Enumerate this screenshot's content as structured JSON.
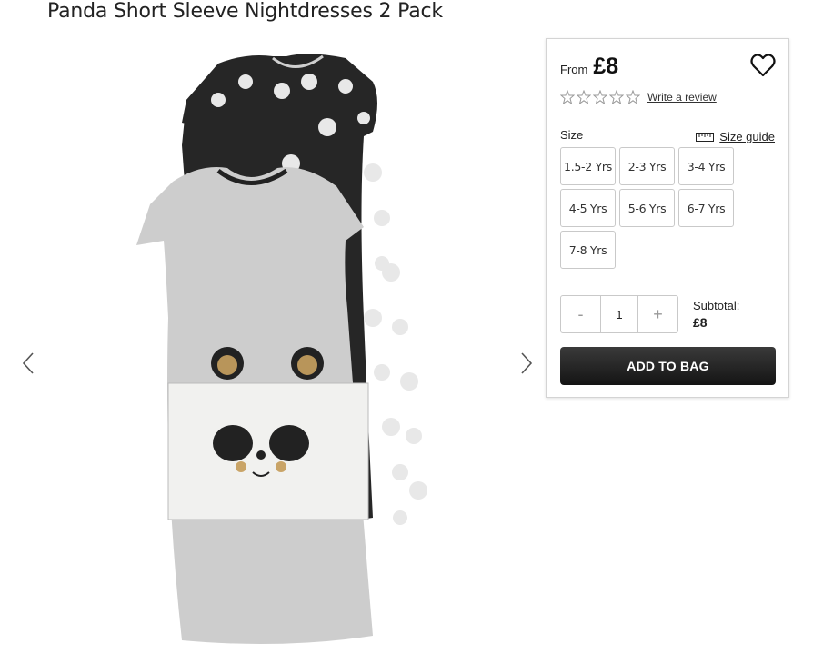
{
  "product": {
    "title": "Panda Short Sleeve Nightdresses 2 Pack"
  },
  "gallery": {
    "prev_icon": "chevron-left-icon",
    "next_icon": "chevron-right-icon"
  },
  "purchase": {
    "from_label": "From",
    "price": "£8",
    "rating": {
      "stars": 0,
      "max": 5
    },
    "review_link": "Write a review",
    "size_label": "Size",
    "size_guide_label": "Size guide",
    "sizes": [
      "1.5-2 Yrs",
      "2-3 Yrs",
      "3-4 Yrs",
      "4-5 Yrs",
      "5-6 Yrs",
      "6-7 Yrs",
      "7-8 Yrs"
    ],
    "quantity": {
      "decrement": "-",
      "value": "1",
      "increment": "+"
    },
    "subtotal_label": "Subtotal:",
    "subtotal_value": "£8",
    "add_to_bag": "ADD TO BAG"
  },
  "colors": {
    "button_dark": "#1a1a1a",
    "border": "#c9c9c9"
  }
}
